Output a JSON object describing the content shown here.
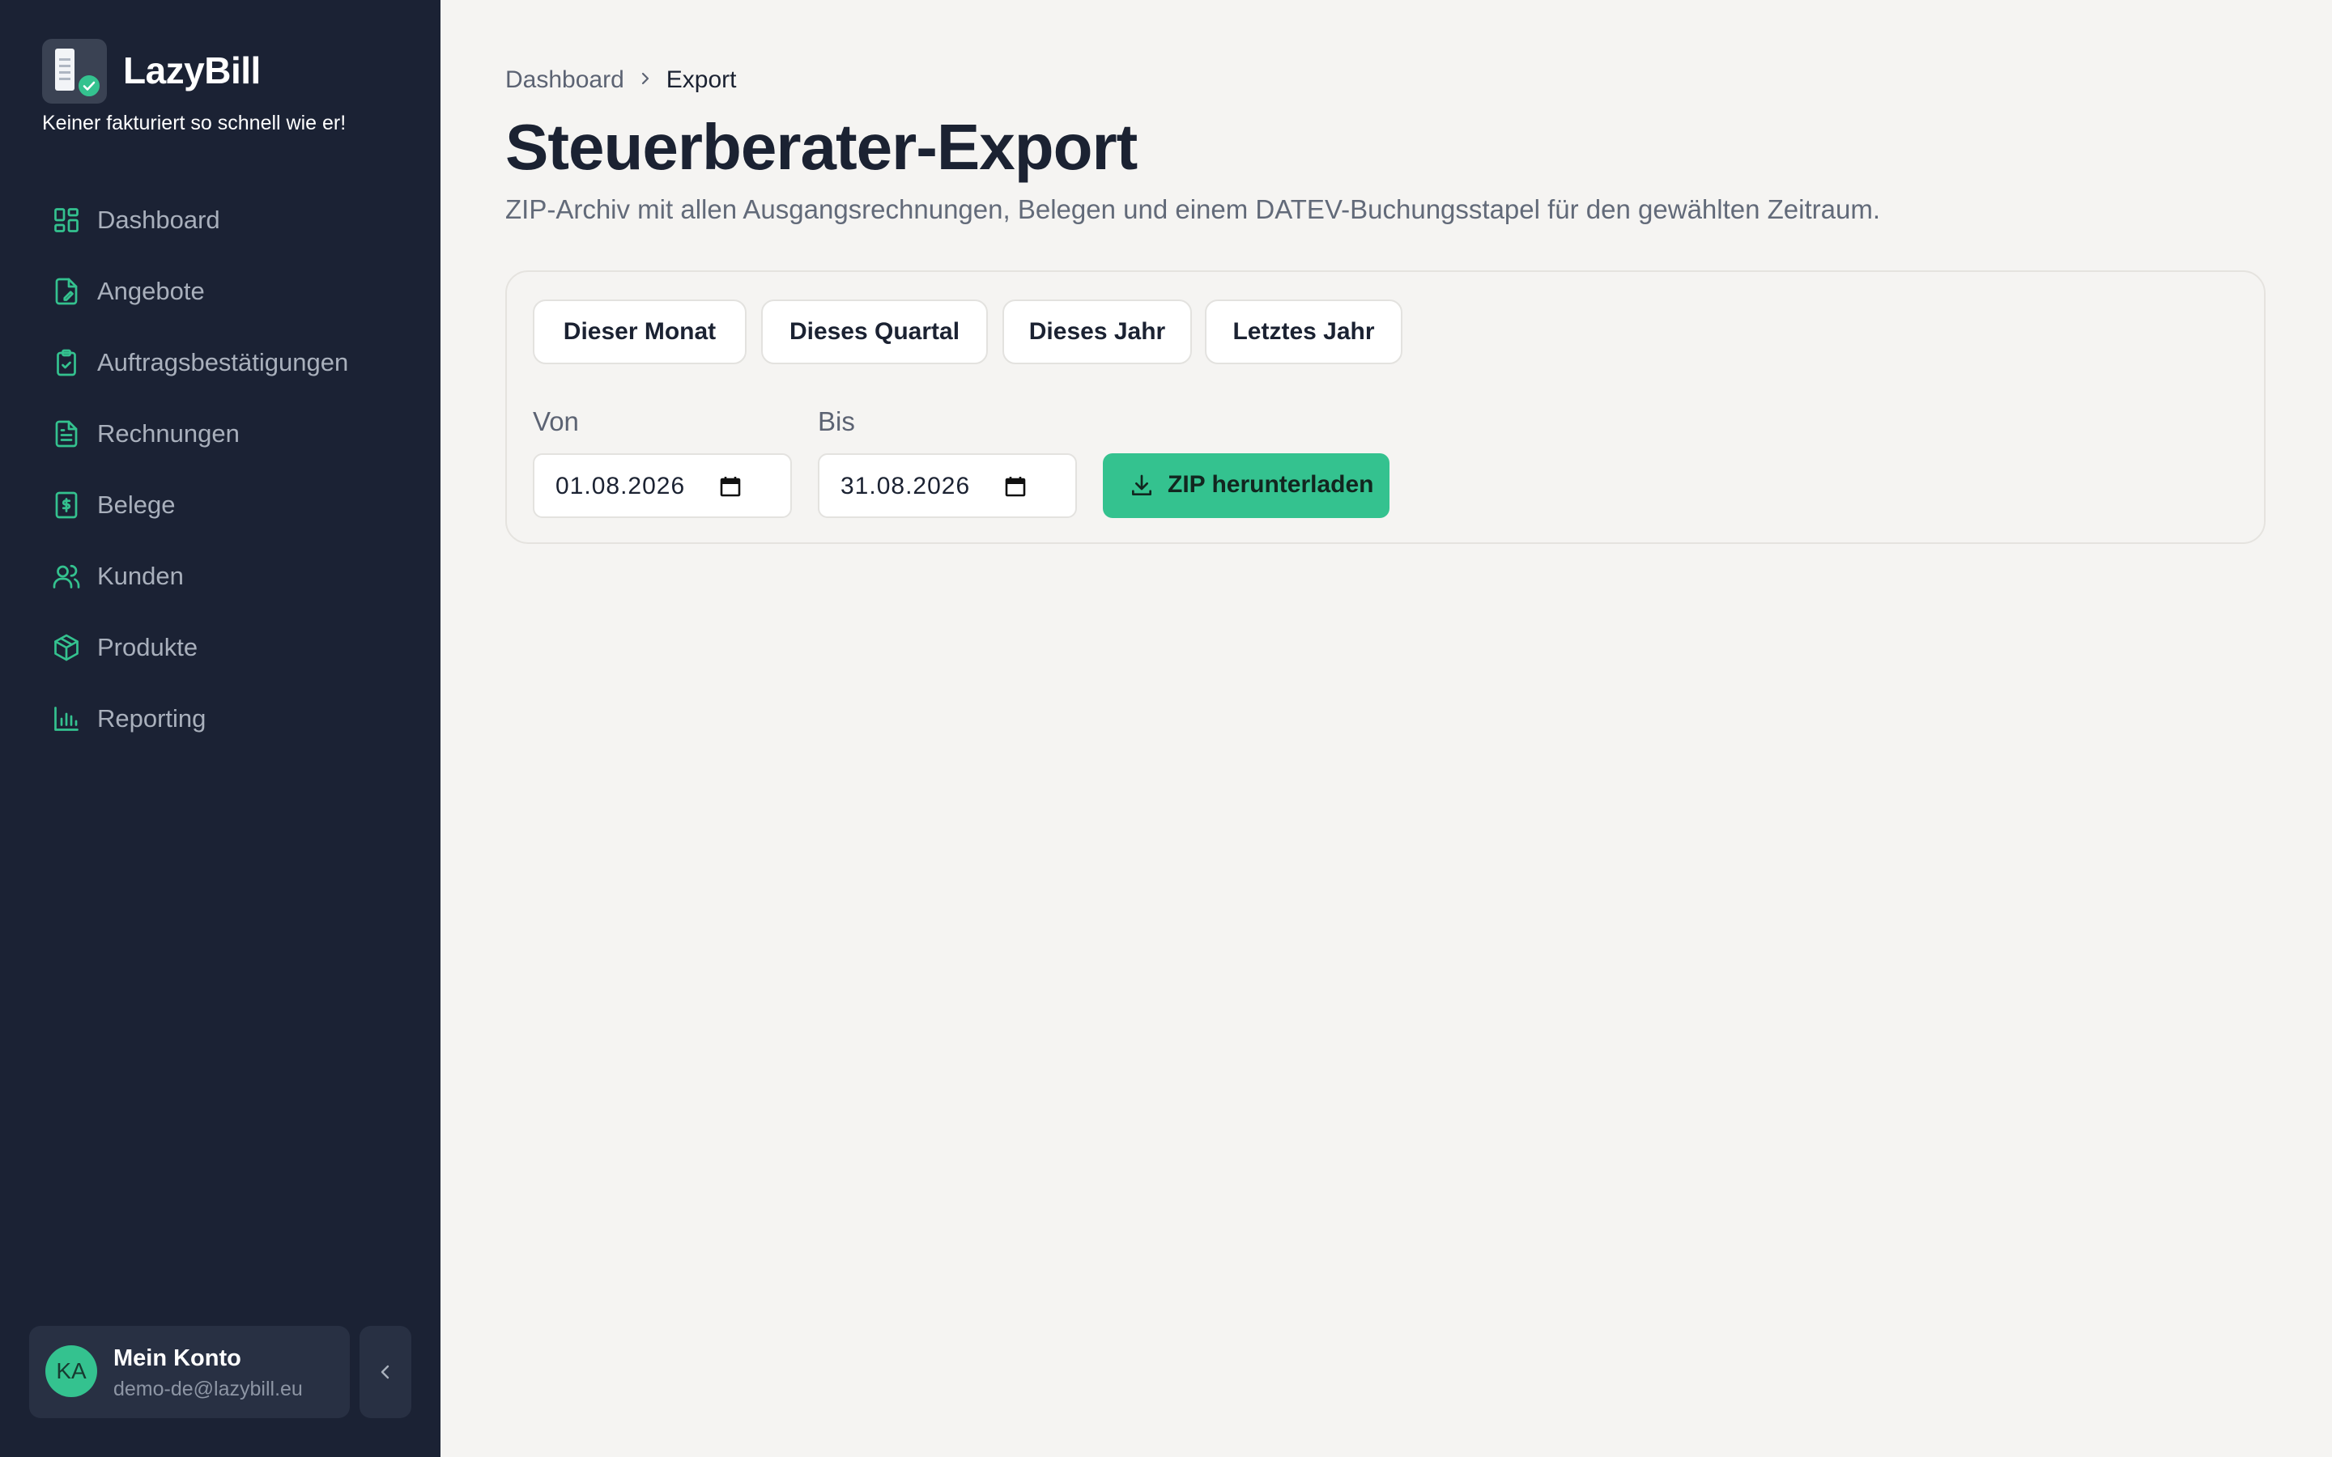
{
  "app": {
    "name": "LazyBill",
    "tagline": "Keiner fakturiert so schnell wie er!"
  },
  "sidebar": {
    "items": [
      {
        "label": "Dashboard",
        "icon": "layout-grid-icon"
      },
      {
        "label": "Angebote",
        "icon": "file-edit-icon"
      },
      {
        "label": "Auftragsbestätigungen",
        "icon": "clipboard-check-icon"
      },
      {
        "label": "Rechnungen",
        "icon": "file-text-icon"
      },
      {
        "label": "Belege",
        "icon": "receipt-icon"
      },
      {
        "label": "Kunden",
        "icon": "users-icon"
      },
      {
        "label": "Produkte",
        "icon": "package-icon"
      },
      {
        "label": "Reporting",
        "icon": "bar-chart-icon"
      }
    ],
    "account": {
      "initials": "KA",
      "name": "Mein Konto",
      "email": "demo-de@lazybill.eu"
    }
  },
  "breadcrumb": {
    "home": "Dashboard",
    "current": "Export"
  },
  "page": {
    "title": "Steuerberater-Export",
    "description": "ZIP-Archiv mit allen Ausgangsrechnungen, Belegen und einem DATEV-Buchungsstapel für den gewählten Zeitraum."
  },
  "export": {
    "presets": [
      "Dieser Monat",
      "Dieses Quartal",
      "Dieses Jahr",
      "Letztes Jahr"
    ],
    "from_label": "Von",
    "from_value": "01.08.2026",
    "to_label": "Bis",
    "to_value": "31.08.2026",
    "download_label": "ZIP herunterladen"
  },
  "colors": {
    "sidebar_bg": "#1b2234",
    "accent": "#34c28f",
    "page_bg": "#f5f4f2",
    "text_dark": "#1b2232"
  }
}
